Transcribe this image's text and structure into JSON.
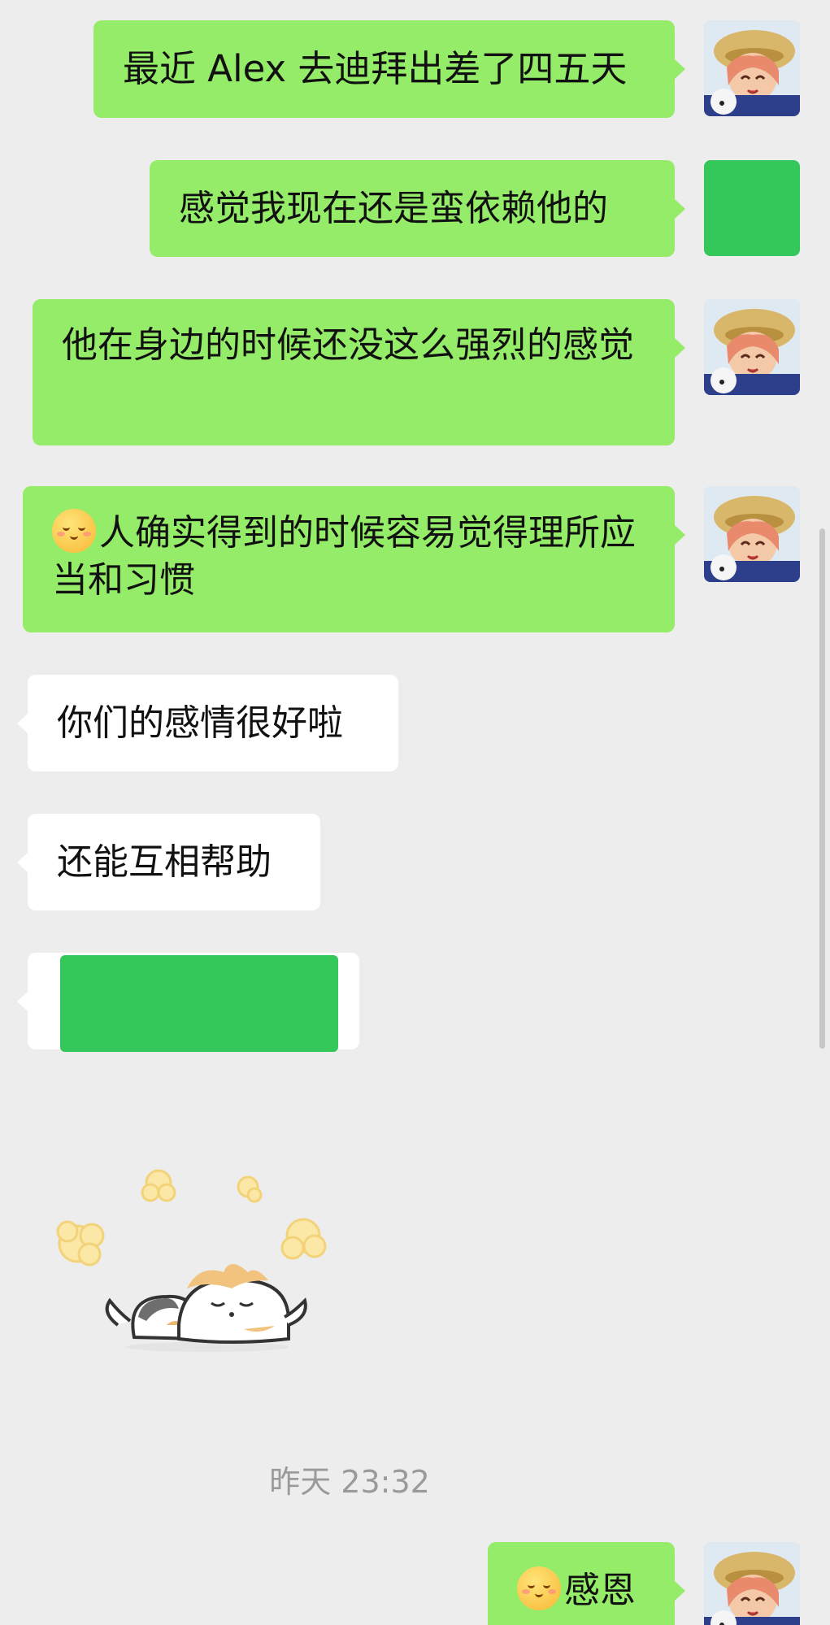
{
  "messages": [
    {
      "side": "right",
      "text": "最近 Alex 去迪拜出差了四五天"
    },
    {
      "side": "right",
      "text": "感觉我现在还是蛮依赖他的"
    },
    {
      "side": "right",
      "text": "他在身边的时候还没这么强烈的感觉"
    },
    {
      "side": "right",
      "text": "人确实得到的时候容易觉得理所应当和习惯",
      "emoji": "smiling-face-icon"
    },
    {
      "side": "left",
      "text": "你们的感情很好啦"
    },
    {
      "side": "left",
      "text": "还能互相帮助"
    },
    {
      "side": "left",
      "text": "",
      "redacted": true
    },
    {
      "side": "left",
      "sticker": "sleeping-cats-sticker"
    },
    {
      "side": "right",
      "text": "感恩",
      "emoji": "smiling-face-icon"
    }
  ],
  "timestamp": "昨天 23:32",
  "colors": {
    "background": "#ededed",
    "outgoing_bubble": "#95ec69",
    "incoming_bubble": "#ffffff",
    "redaction": "#34c759",
    "timestamp_text": "#9a9a9a"
  }
}
